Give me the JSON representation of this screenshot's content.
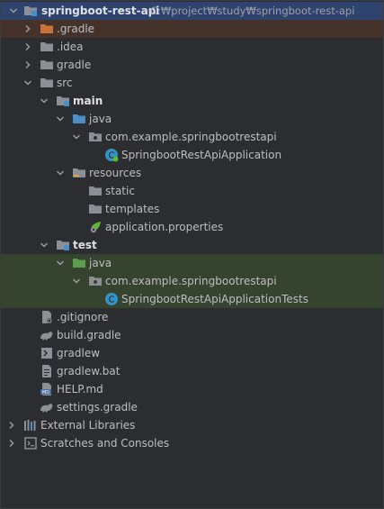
{
  "project": {
    "name": "springboot-rest-api",
    "path": "C:₩project₩study₩springboot-rest-api"
  },
  "tree": {
    "gradle_hidden": ".gradle",
    "idea": ".idea",
    "gradle": "gradle",
    "src": "src",
    "main": "main",
    "main_java": "java",
    "main_package": "com.example.springbootrestapi",
    "main_class": "SpringbootRestApiApplication",
    "resources": "resources",
    "static": "static",
    "templates": "templates",
    "app_props": "application.properties",
    "test": "test",
    "test_java": "java",
    "test_package": "com.example.springbootrestapi",
    "test_class": "SpringbootRestApiApplicationTests",
    "gitignore": ".gitignore",
    "build_gradle": "build.gradle",
    "gradlew": "gradlew",
    "gradlew_bat": "gradlew.bat",
    "help_md": "HELP.md",
    "settings_gradle": "settings.gradle",
    "external_libraries": "External Libraries",
    "scratches": "Scratches and Consoles"
  },
  "colors": {
    "background": "#2b2d30",
    "selected_row": "#2e436e",
    "excluded_row": "#45322b",
    "test_row": "#36432f",
    "folder": "#8c8f96",
    "source_folder": "#4a8fc7",
    "test_folder": "#5b9e4d",
    "excluded_folder": "#c9733a"
  }
}
